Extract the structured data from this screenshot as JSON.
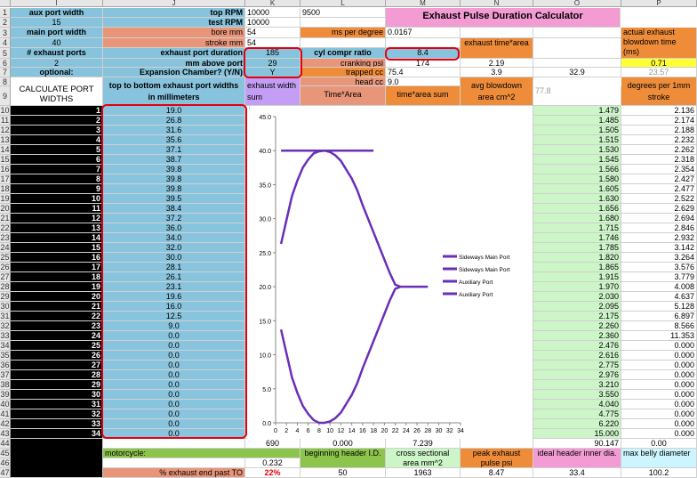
{
  "columns": [
    "I",
    "J",
    "K",
    "L",
    "M",
    "N",
    "O",
    "P"
  ],
  "rows": [
    "1",
    "2",
    "3",
    "4",
    "5",
    "6",
    "7",
    "8",
    "9",
    "10",
    "11",
    "12",
    "13",
    "14",
    "15",
    "16",
    "17",
    "18",
    "19",
    "20",
    "21",
    "22",
    "23",
    "24",
    "25",
    "26",
    "27",
    "28",
    "29",
    "30",
    "31",
    "32",
    "33",
    "34",
    "35",
    "36",
    "37",
    "38",
    "39",
    "40",
    "41",
    "42",
    "43",
    "44",
    "45",
    "46",
    "47"
  ],
  "inputs": {
    "aux_port_width_label": "aux port width",
    "aux_port_width": "15",
    "main_port_width_label": "main port width",
    "main_port_width": "40",
    "num_ports_label": "# exhaust ports",
    "num_ports": "2",
    "optional_label": "optional:",
    "calc_label": "CALCULATE PORT WIDTHS",
    "top_rpm_label": "top RPM",
    "top_rpm": "10000",
    "top_rpm_l": "9500",
    "test_rpm_label": "test RPM",
    "test_rpm": "10000",
    "bore_label": "bore mm",
    "bore": "54",
    "stroke_label": "stroke mm",
    "stroke": "54",
    "duration_label": "exhaust port duration",
    "duration": "185",
    "mm_above_label": "mm above port",
    "mm_above": "29",
    "exp_label": "Expansion Chamber? (Y/N)",
    "exp": "Y",
    "widths_label": "top to bottom exhaust port widths in millimeters"
  },
  "title": "Exhaust Pulse Duration Calculator",
  "misc": {
    "ms_per_degree_label": "ms per degree",
    "ms_per_degree": "0.0167",
    "cyl_compr_label": "cyl compr ratio",
    "cyl_compr": "8.4",
    "exhaust_time_area_label": "exhaust time*area",
    "actual_blowdown_label": "actual exhaust blowdown time (ms)",
    "actual_blowdown": "0.71",
    "cranking_label": "cranking psi",
    "cranking": "174",
    "n6": "2.19",
    "trapped_label": "trapped cc",
    "trapped": "75.4",
    "n7": "3.9",
    "o7": "32.9",
    "p7": "23.57",
    "head_label": "head cc",
    "head": "9.0",
    "o8": "77.8",
    "exh_width_sum_label": "exhaust width sum",
    "time_area_label": "Time*Area",
    "time_area_sum_label": "time*area sum",
    "avg_blowdown_label": "avg blowdown area cm^2",
    "deg_per_mm_label": "degrees per 1mm stroke"
  },
  "port_numbers": [
    "1",
    "2",
    "3",
    "4",
    "5",
    "6",
    "7",
    "8",
    "9",
    "10",
    "11",
    "12",
    "13",
    "14",
    "15",
    "16",
    "17",
    "18",
    "19",
    "20",
    "21",
    "22",
    "23",
    "24",
    "25",
    "26",
    "27",
    "28",
    "29",
    "30",
    "31",
    "32",
    "33",
    "34"
  ],
  "port_widths": [
    "19.0",
    "26.8",
    "31.6",
    "35.6",
    "37.1",
    "38.7",
    "39.8",
    "39.8",
    "39.8",
    "39.5",
    "38.4",
    "37.2",
    "36.0",
    "34.0",
    "32.0",
    "30.0",
    "28.1",
    "26.1",
    "23.1",
    "19.6",
    "16.0",
    "12.5",
    "9.0",
    "0.0",
    "0.0",
    "0.0",
    "0.0",
    "0.0",
    "0.0",
    "0.0",
    "0.0",
    "0.0",
    "0.0",
    "0.0"
  ],
  "col_o": [
    "1.479",
    "1.485",
    "1.505",
    "1.515",
    "1.530",
    "1.545",
    "1.566",
    "1.580",
    "1.605",
    "1.630",
    "1.656",
    "1.680",
    "1.715",
    "1.746",
    "1.785",
    "1.820",
    "1.865",
    "1.915",
    "1.970",
    "2.030",
    "2.095",
    "2.175",
    "2.260",
    "2.360",
    "2.476",
    "2.616",
    "2.775",
    "2.976",
    "3.210",
    "3.550",
    "4.040",
    "4.775",
    "6.220",
    "15.000"
  ],
  "col_p": [
    "2.136",
    "2.174",
    "2.188",
    "2.232",
    "2.262",
    "2.318",
    "2.354",
    "2.427",
    "2.477",
    "2.522",
    "2.629",
    "2.694",
    "2.846",
    "2.932",
    "3.142",
    "3.264",
    "3.576",
    "3.779",
    "4.008",
    "4.637",
    "5.128",
    "6.897",
    "8.566",
    "11.353",
    "0.000",
    "0.000",
    "0.000",
    "0.000",
    "0.000",
    "0.000",
    "0.000",
    "0.000",
    "0.000",
    "0.000"
  ],
  "row44": {
    "k": "690",
    "l": "0.000",
    "m": "7.239",
    "o": "90.147",
    "p": "0.00"
  },
  "row45": {
    "motorcycle_label": "motorcycle:",
    "beginning_label": "beginning header I.D.",
    "cross_label": "cross sectional area mm^2",
    "peak_label": "peak exhaust pulse psi",
    "ideal_label": "ideal header inner dia.",
    "max_belly_label": "max belly diameter"
  },
  "row46": {
    "k": "0.232",
    "l": "50",
    "m": "1963",
    "n": "8.47",
    "o": "33.4",
    "p": "100.2"
  },
  "row47": {
    "label": "% exhaust end past TO",
    "k": "22%"
  },
  "colors": {
    "accent_red": "#e3000f",
    "series": "#6a2fb8"
  },
  "chart_data": {
    "type": "line",
    "ylim": [
      0,
      45
    ],
    "xlim": [
      0,
      34
    ],
    "yticks": [
      "0.0",
      "5.0",
      "10.0",
      "15.0",
      "20.0",
      "25.0",
      "30.0",
      "35.0",
      "40.0",
      "45.0"
    ],
    "xticks": [
      "0",
      "2",
      "4",
      "6",
      "8",
      "10",
      "12",
      "14",
      "16",
      "18",
      "20",
      "22",
      "24",
      "26",
      "28",
      "30",
      "32",
      "34"
    ],
    "legend": [
      "Sideways Main Port",
      "Sideways Main Port",
      "Auxiliary Port",
      "Auxiliary Port"
    ],
    "series": [
      {
        "name": "Sideways Main Port",
        "x": [
          1,
          4,
          6,
          8,
          10,
          12,
          14,
          16,
          18
        ],
        "y": [
          40,
          40,
          40,
          40,
          40,
          40,
          40,
          40,
          40
        ]
      },
      {
        "name": "Sideways Main Port",
        "x": [
          1,
          2,
          3,
          4,
          5,
          6,
          7,
          8,
          9,
          10,
          11,
          12,
          13,
          14,
          15,
          16,
          17,
          18,
          19,
          20,
          21,
          22,
          23
        ],
        "y": [
          26.3,
          29.8,
          33.3,
          35.6,
          37.5,
          38.7,
          39.6,
          39.9,
          40.0,
          39.8,
          39.3,
          38.5,
          37.2,
          35.9,
          34.2,
          32.0,
          30.0,
          28.0,
          26.0,
          24.0,
          22.0,
          20.3,
          20.0
        ]
      },
      {
        "name": "Auxiliary Port",
        "x": [
          23,
          24,
          25,
          26,
          27,
          28
        ],
        "y": [
          20.0,
          20.0,
          20.0,
          20.0,
          20.0,
          20.0
        ]
      },
      {
        "name": "Auxiliary Port",
        "x": [
          1,
          2,
          3,
          4,
          5,
          6,
          7,
          8,
          9,
          10,
          11,
          12,
          13,
          14,
          15,
          16,
          17,
          18,
          19,
          20,
          21,
          22,
          23
        ],
        "y": [
          13.7,
          10.2,
          6.7,
          4.4,
          2.5,
          1.3,
          0.4,
          0.0,
          0.0,
          0.2,
          0.7,
          1.5,
          2.8,
          4.1,
          5.8,
          8.0,
          10.0,
          12.0,
          14.0,
          16.0,
          18.0,
          19.7,
          20.0
        ]
      }
    ]
  }
}
